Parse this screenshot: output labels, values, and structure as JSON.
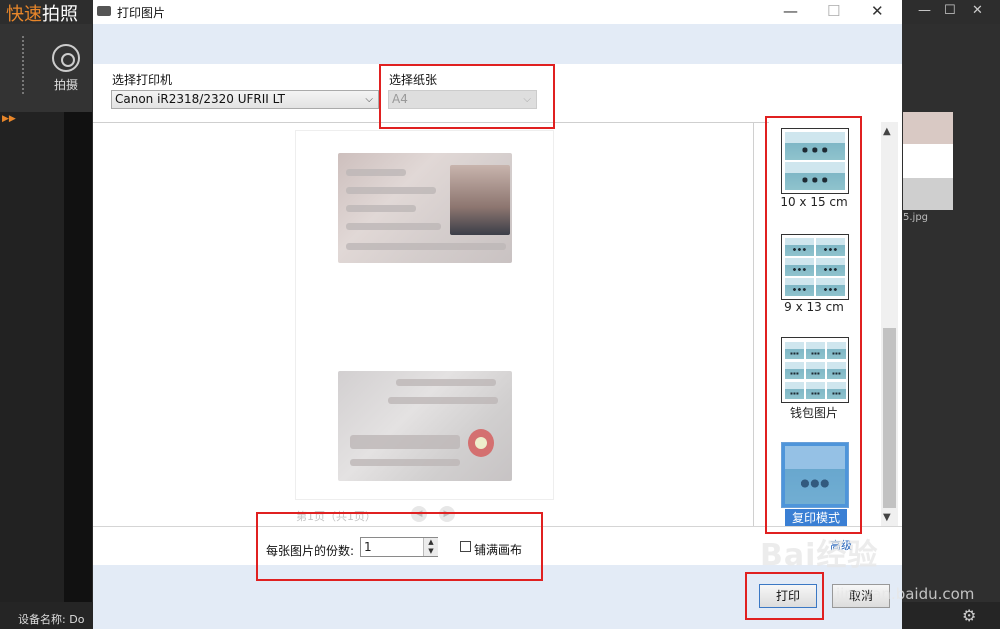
{
  "app": {
    "logo_accent": "快速",
    "logo_rest": "拍照",
    "capture_label": "拍摄",
    "thumb_filename": "5.jpg",
    "device_label": "设备名称:",
    "device_value": "Do"
  },
  "dialog": {
    "title": "打印图片",
    "printer_label": "选择打印机",
    "printer_value": "Canon iR2318/2320 UFRII LT",
    "paper_label": "选择纸张",
    "paper_value": "A4",
    "pager_text": "第1页（共1页）",
    "copies_label": "每张图片的份数:",
    "copies_value": "1",
    "fill_label": "铺满画布",
    "advanced_label": "高级",
    "print_button": "打印",
    "cancel_button": "取消"
  },
  "layouts": [
    {
      "label": "10 x 15 cm",
      "selected": false
    },
    {
      "label": "9 x 13 cm",
      "selected": false
    },
    {
      "label": "钱包图片",
      "selected": false
    },
    {
      "label": "复印模式",
      "selected": true
    }
  ],
  "watermark": {
    "brand": "Bai经验",
    "url": "jingyan.baidu.com"
  },
  "colors": {
    "accent": "#e8862a",
    "annotation": "#e02020",
    "selection": "#3a7fd4"
  }
}
